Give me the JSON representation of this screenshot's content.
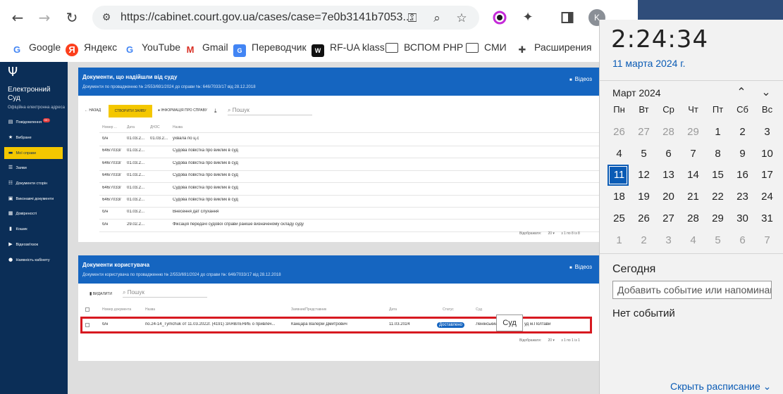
{
  "browser": {
    "url": "https://cabinet.court.gov.ua/cases/case=7e0b3141b7053...",
    "profile_initial": "K",
    "bookmarks": [
      {
        "label": "Google",
        "icon": "google-icon"
      },
      {
        "label": "Яндекс",
        "icon": "yandex-icon"
      },
      {
        "label": "YouTube",
        "icon": "google-icon"
      },
      {
        "label": "Gmail",
        "icon": "gmail-icon"
      },
      {
        "label": "Переводчик",
        "icon": "translate-icon"
      },
      {
        "label": "RF-UA klass",
        "icon": "rfua-icon"
      },
      {
        "label": "ВСПОМ PHP",
        "icon": "folder-icon"
      },
      {
        "label": "СМИ",
        "icon": "folder-icon"
      },
      {
        "label": "Расширения",
        "icon": "puzzle-icon"
      }
    ]
  },
  "sidebar": {
    "title": "Електронний Суд",
    "subtitle": "Офіційна електронна адреса",
    "items": [
      {
        "label": "Повідомлення",
        "badge": "99+"
      },
      {
        "label": "Вибране"
      },
      {
        "label": "Мої справи",
        "active": true
      },
      {
        "label": "Заяви"
      },
      {
        "label": "Документи сторін"
      },
      {
        "label": "Виконавчі документи"
      },
      {
        "label": "Довіреності"
      },
      {
        "label": "Кошик"
      },
      {
        "label": "Відеозв'язок"
      },
      {
        "label": "Наявність кабінету"
      }
    ]
  },
  "court_docs": {
    "title": "Документи, що надійшли від суду",
    "subtitle": "Документи по провадженню № 2/553/691/2024 до справи №: 646/7033/17 від 28.12.2018",
    "video_label": "Відеоз",
    "back_label": "НАЗАД",
    "create_label": "СТВОРИТИ ЗАЯВУ",
    "info_label": "ІНФОРМАЦІЯ ПРО СПРАВУ",
    "search_placeholder": "Пошук",
    "columns": [
      "Номер ...",
      "Дата",
      "ДНЗС",
      "Назва"
    ],
    "rows": [
      {
        "num": "б/н",
        "date": "01.03.2...",
        "dnzs": "01.03.2...",
        "name": "ухвала по ц.с"
      },
      {
        "num": "646/7033/",
        "date": "01.03.2...",
        "dnzs": "",
        "name": "Судова повістка про виклик в суд"
      },
      {
        "num": "646/7033/",
        "date": "01.03.2...",
        "dnzs": "",
        "name": "Судова повістка про виклик в суд"
      },
      {
        "num": "646/7033/",
        "date": "01.03.2...",
        "dnzs": "",
        "name": "Судова повістка про виклик в суд"
      },
      {
        "num": "646/7033/",
        "date": "01.03.2...",
        "dnzs": "",
        "name": "Судова повістка про виклик в суд"
      },
      {
        "num": "646/7033/",
        "date": "01.03.2...",
        "dnzs": "",
        "name": "Судова повістка про виклик в суд"
      },
      {
        "num": "б/н",
        "date": "01.03.2...",
        "dnzs": "",
        "name": "Внесення дат слухання"
      },
      {
        "num": "б/н",
        "date": "29.02.2...",
        "dnzs": "",
        "name": "Фіксація передачі судової справи раніше визначеному складу суду"
      }
    ],
    "pager_label": "Відображати:",
    "pager_size": "20",
    "pager_range": "з 1 по 8 із 8"
  },
  "user_docs": {
    "title": "Документи користувача",
    "subtitle": "Документи користувача по провадженню № 2/553/691/2024 до справи №: 646/7033/17 від 28.12.2018",
    "video_label": "Відеоз",
    "delete_label": "ВИДАЛИТИ",
    "search_placeholder": "Пошук",
    "columns": [
      "Номер документа",
      "Назва",
      "Заявник/Представник",
      "Дата",
      "Статус",
      "Суд"
    ],
    "row": {
      "num": "б/н",
      "name": "по.24-14_Tymchuk от 11.03.2022г. (4191) ЗАЯВЛЕНИЕ о привлеч...",
      "applicant": "Канцара Валерій Дмитрович",
      "date": "11.03.2024",
      "status": "Доставлено",
      "court_a": "Ленінський",
      "court_b": "уд м.Полтави"
    },
    "tooltip": "Суд",
    "pager_label": "Відображати:",
    "pager_size": "20",
    "pager_range": "з 1 по 1 із 1"
  },
  "calendar": {
    "time": "2:24:34",
    "date_link": "11 марта 2024 г.",
    "month": "Март 2024",
    "weekdays": [
      "Пн",
      "Вт",
      "Ср",
      "Чт",
      "Пт",
      "Сб",
      "Вс"
    ],
    "weeks": [
      [
        "26",
        "27",
        "28",
        "29",
        "1",
        "2",
        "3"
      ],
      [
        "4",
        "5",
        "6",
        "7",
        "8",
        "9",
        "10"
      ],
      [
        "11",
        "12",
        "13",
        "14",
        "15",
        "16",
        "17"
      ],
      [
        "18",
        "19",
        "20",
        "21",
        "22",
        "23",
        "24"
      ],
      [
        "25",
        "26",
        "27",
        "28",
        "29",
        "30",
        "31"
      ],
      [
        "1",
        "2",
        "3",
        "4",
        "5",
        "6",
        "7"
      ]
    ],
    "today": "11",
    "today_label": "Сегодня",
    "event_placeholder": "Добавить событие или напоминание",
    "no_events": "Нет событий",
    "hide_schedule": "Скрыть расписание"
  },
  "colors": {
    "sidebar_bg": "#0b2e57",
    "panel_header": "#1565c0",
    "accent_yellow": "#f4c700",
    "highlight_red": "#d71920",
    "calendar_accent": "#0a5bb5"
  }
}
